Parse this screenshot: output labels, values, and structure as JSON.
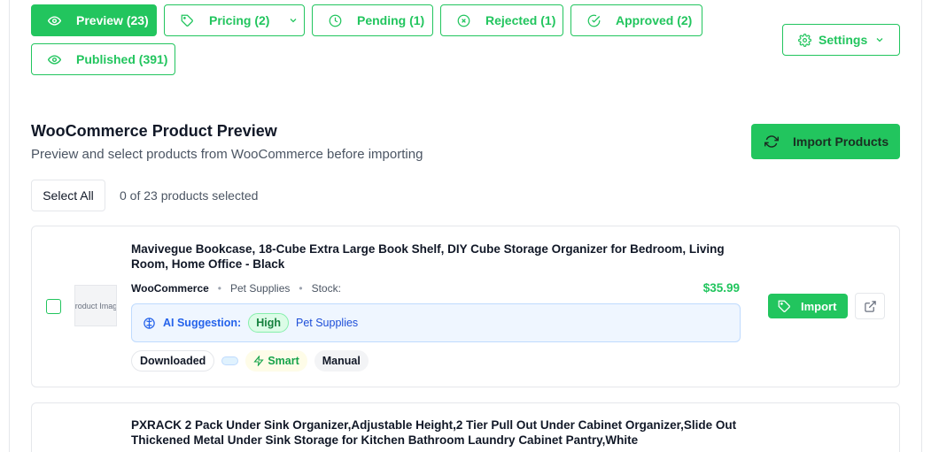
{
  "tabs": [
    {
      "label": "Preview (23)",
      "icon": "eye-icon",
      "active": true
    },
    {
      "label": "Pricing (2)",
      "icon": "tag-icon",
      "active": false,
      "dropdown": true
    },
    {
      "label": "Pending (1)",
      "icon": "clock-icon",
      "active": false
    },
    {
      "label": "Rejected (1)",
      "icon": "x-circle-icon",
      "active": false
    },
    {
      "label": "Approved (2)",
      "icon": "check-circle-icon",
      "active": false
    },
    {
      "label": "Published (391)",
      "icon": "eye-icon",
      "active": false
    }
  ],
  "settings": {
    "label": "Settings",
    "icon": "gear-icon"
  },
  "header": {
    "title": "WooCommerce Product Preview",
    "subtitle": "Preview and select products from WooCommerce before importing",
    "import_label": "Import Products"
  },
  "selection": {
    "select_all_label": "Select All",
    "count_text": "0 of 23 products selected"
  },
  "products": [
    {
      "title": "Mavivegue Bookcase, 18-Cube Extra Large Book Shelf, DIY Cube Storage Organizer for Bedroom, Living Room, Home Office - Black",
      "image_placeholder": "Product Image",
      "source": "WooCommerce",
      "category": "Pet Supplies",
      "stock_label": "Stock:",
      "price": "$35.99",
      "ai_label": "AI Suggestion:",
      "ai_confidence": "High",
      "ai_category": "Pet Supplies",
      "chips": {
        "status": "Downloaded",
        "smart": "Smart",
        "manual": "Manual"
      },
      "import_label": "Import"
    },
    {
      "title": "PXRACK 2 Pack Under Sink Organizer,Adjustable Height,2 Tier Pull Out Under Cabinet Organizer,Slide Out Thickened Metal Under Sink Storage for Kitchen Bathroom Laundry Cabinet Pantry,White"
    }
  ],
  "colors": {
    "accent": "#22c55e",
    "ai_bg": "#eff6ff",
    "ai_text": "#1d4ed8"
  }
}
